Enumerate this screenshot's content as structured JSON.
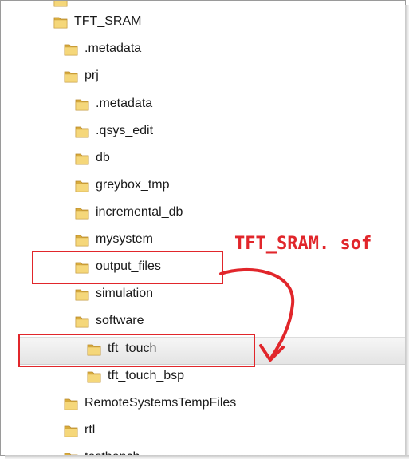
{
  "tree": {
    "items": [
      {
        "label": "TFT_SRAM",
        "depth": 0
      },
      {
        "label": ".metadata",
        "depth": 1
      },
      {
        "label": "prj",
        "depth": 1
      },
      {
        "label": ".metadata",
        "depth": 2
      },
      {
        "label": ".qsys_edit",
        "depth": 2
      },
      {
        "label": "db",
        "depth": 2
      },
      {
        "label": "greybox_tmp",
        "depth": 2
      },
      {
        "label": "incremental_db",
        "depth": 2
      },
      {
        "label": "mysystem",
        "depth": 2
      },
      {
        "label": "output_files",
        "depth": 2
      },
      {
        "label": "simulation",
        "depth": 2
      },
      {
        "label": "software",
        "depth": 2
      },
      {
        "label": "tft_touch",
        "depth": 3,
        "selected": true
      },
      {
        "label": "tft_touch_bsp",
        "depth": 3
      },
      {
        "label": "RemoteSystemsTempFiles",
        "depth": 1
      },
      {
        "label": "rtl",
        "depth": 1
      },
      {
        "label": "testbench",
        "depth": 1
      }
    ]
  },
  "annotation": {
    "text": "TFT_SRAM. sof",
    "color": "#e1262b"
  },
  "icons": {
    "folder": "folder-icon"
  },
  "colors": {
    "folder_front": "#f5d77a",
    "folder_back": "#d9ac3c",
    "highlight": "#e1262b"
  }
}
